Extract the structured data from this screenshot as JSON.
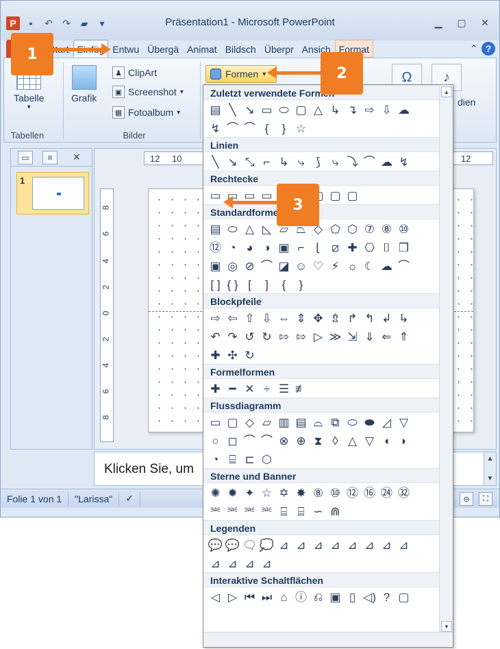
{
  "window": {
    "title": "Präsentation1 - Microsoft PowerPoint",
    "app_icon": "P"
  },
  "tabs": [
    "Start",
    "Einfüg",
    "Entwu",
    "Übergä",
    "Animat",
    "Bildsch",
    "Überpr",
    "Ansich",
    "Format"
  ],
  "active_tab": "Einfüg",
  "ribbon": {
    "tabelle_label": "Tabelle",
    "tabellen_group": "Tabellen",
    "grafik_label": "Grafik",
    "clipart_label": "ClipArt",
    "screenshot_label": "Screenshot",
    "fotoalbum_label": "Fotoalbum",
    "bilder_group": "Bilder",
    "formen_label": "Formen",
    "omega_symbol": "Ω",
    "audio_partial": "dien"
  },
  "left_pane": {
    "slide_number": "1"
  },
  "ruler": {
    "h_ticks": [
      "12",
      "10"
    ],
    "h_right": "12",
    "v_ticks": [
      "8",
      "6",
      "4",
      "2",
      "0",
      "2",
      "4",
      "6",
      "8"
    ]
  },
  "notes": {
    "text": "Klicken Sie, um"
  },
  "statusbar": {
    "slide_info": "Folie 1 von 1",
    "theme": "\"Larissa\""
  },
  "gallery": {
    "sections": [
      {
        "title": "Zuletzt verwendete Formen",
        "rows": [
          [
            "▤",
            "╲",
            "↘",
            "▭",
            "⬭",
            "▢",
            "△",
            "↳",
            "↴",
            "⇨",
            "⇩",
            "☁"
          ],
          [
            "↯",
            "⌒",
            "⌒",
            "{",
            "}",
            "☆"
          ]
        ]
      },
      {
        "title": "Linien",
        "rows": [
          [
            "╲",
            "↘",
            "⤡",
            "⌐",
            "↳",
            "⤷",
            "⟆",
            "⤷",
            "⤵",
            "⌒",
            "☁",
            "↯"
          ]
        ]
      },
      {
        "title": "Rechtecke",
        "rows": [
          [
            "▭",
            "▭",
            "▭",
            "▭",
            "▢",
            "▢",
            "▢",
            "▢",
            "▢"
          ]
        ]
      },
      {
        "title": "Standardformen",
        "rows": [
          [
            "▤",
            "⬭",
            "△",
            "◺",
            "▱",
            "⏢",
            "◇",
            "⬠",
            "⬡",
            "⑦",
            "⑧",
            "⑩"
          ],
          [
            "⑫",
            "◔",
            "◕",
            "◑",
            "▣",
            "⌐",
            "⌊",
            "⧄",
            "✚",
            "⎔",
            "⌷",
            "❒"
          ],
          [
            "▣",
            "◎",
            "⊘",
            "⌒",
            "◪",
            "☺",
            "♡",
            "⚡",
            "☼",
            "☾",
            "☁",
            "⌒"
          ],
          [
            "[ ]",
            "{ }",
            "[",
            "]",
            "{",
            "}"
          ]
        ]
      },
      {
        "title": "Blockpfeile",
        "rows": [
          [
            "⇨",
            "⇦",
            "⇧",
            "⇩",
            "⇔",
            "⇕",
            "✥",
            "⇯",
            "↱",
            "↰",
            "↲",
            "↳"
          ],
          [
            "↶",
            "↷",
            "↺",
            "↻",
            "⇰",
            "⇰",
            "▷",
            "≫",
            "⇲",
            "⇓",
            "⇐",
            "⇑"
          ],
          [
            "✚",
            "✣",
            "↻"
          ]
        ]
      },
      {
        "title": "Formelformen",
        "rows": [
          [
            "✚",
            "━",
            "✕",
            "÷",
            "☰",
            "≢"
          ]
        ]
      },
      {
        "title": "Flussdiagramm",
        "rows": [
          [
            "▭",
            "▢",
            "◇",
            "▱",
            "▥",
            "▤",
            "⌓",
            "⧉",
            "⬭",
            "⬬",
            "◿",
            "▽"
          ],
          [
            "○",
            "◻",
            "⌒",
            "⌒",
            "⊗",
            "⊕",
            "⧗",
            "◊",
            "△",
            "▽",
            "◖",
            "◗"
          ],
          [
            "◔",
            "⌸",
            "⊏",
            "⬡"
          ]
        ]
      },
      {
        "title": "Sterne und Banner",
        "rows": [
          [
            "✺",
            "✹",
            "✦",
            "☆",
            "✡",
            "✸",
            "⑧",
            "⑩",
            "⑫",
            "⑯",
            "㉔",
            "㉜"
          ],
          [
            "⎃",
            "⎃",
            "⎃",
            "⎃",
            "⌸",
            "⌸",
            "∽",
            "⋒"
          ]
        ]
      },
      {
        "title": "Legenden",
        "rows": [
          [
            "💬",
            "💬",
            "🗨",
            "💭",
            "⊿",
            "⊿",
            "⊿",
            "⊿",
            "⊿",
            "⊿",
            "⊿",
            "⊿"
          ],
          [
            "⊿",
            "⊿",
            "⊿",
            "⊿"
          ]
        ]
      },
      {
        "title": "Interaktive Schaltflächen",
        "rows": [
          [
            "◁",
            "▷",
            "⏮",
            "⏭",
            "⌂",
            "ⓘ",
            "⎌",
            "▣",
            "▯",
            "◁)",
            "?",
            "▢"
          ]
        ]
      }
    ]
  },
  "callouts": [
    "1",
    "2",
    "3"
  ],
  "colors": {
    "callout": "#f07d23",
    "ppt_brand": "#d24726",
    "formen_highlight": "#ffd45a"
  }
}
